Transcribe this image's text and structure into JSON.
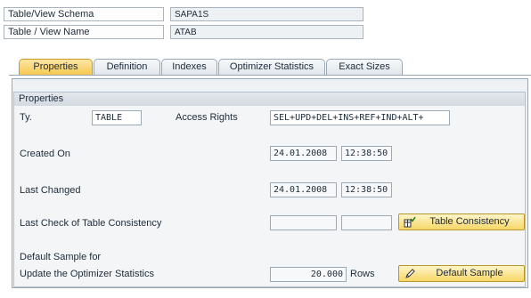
{
  "header": {
    "schema_label": "Table/View Schema",
    "schema_value": "SAPA1S",
    "name_label": "Table / View Name",
    "name_value": "ATAB"
  },
  "tabs": [
    {
      "label": "Properties",
      "active": true
    },
    {
      "label": "Definition",
      "active": false
    },
    {
      "label": "Indexes",
      "active": false
    },
    {
      "label": "Optimizer Statistics",
      "active": false
    },
    {
      "label": "Exact Sizes",
      "active": false
    }
  ],
  "properties": {
    "group_title": "Properties",
    "type_label": "Ty.",
    "type_value": "TABLE",
    "access_rights_label": "Access Rights",
    "access_rights_value": "SEL+UPD+DEL+INS+REF+IND+ALT+",
    "created_on_label": "Created On",
    "created_on_date": "24.01.2008",
    "created_on_time": "12:38:50",
    "last_changed_label": "Last Changed",
    "last_changed_date": "24.01.2008",
    "last_changed_time": "12:38:50",
    "last_check_label": "Last Check of Table Consistency",
    "last_check_date": "",
    "last_check_time": "",
    "table_consistency_button": "Table Consistency",
    "default_sample_line1": "Default Sample for",
    "default_sample_line2": "Update the Optimizer Statistics",
    "sample_value": "20.000",
    "rows_label": "Rows",
    "default_sample_button": "Default Sample"
  },
  "colors": {
    "active_tab": "#f5c64a",
    "button": "#f7d767",
    "panel_bg": "#eef2f5"
  },
  "icons": {
    "table_consistency": "table-check-icon",
    "default_sample": "pencil-icon"
  }
}
